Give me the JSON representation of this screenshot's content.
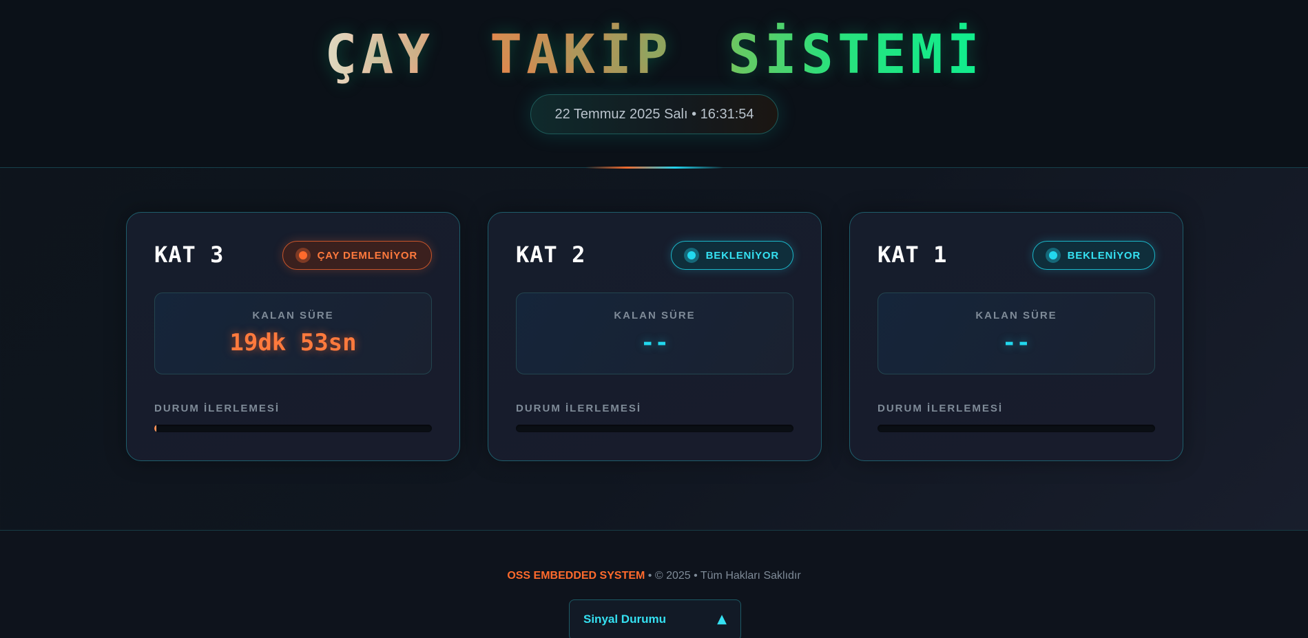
{
  "header": {
    "title_parts": [
      {
        "text": "ÇAY",
        "color": "#f0b896"
      },
      {
        "text": "TAKİP",
        "color": "#d98a4c"
      },
      {
        "text": "SİSTEMİ",
        "color": "#16e88c"
      }
    ],
    "datetime": "22 Temmuz 2025 Salı • 16:31:54"
  },
  "cards": [
    {
      "title": "KAT 3",
      "status": "ÇAY DEMLENİYOR",
      "status_type": "brewing",
      "status_color": "#ff7a3d",
      "remaining_label": "KALAN SÜRE",
      "remaining_value": "19dk 53sn",
      "progress_label": "DURUM İLERLEMESİ",
      "progress": 0.005
    },
    {
      "title": "KAT 2",
      "status": "BEKLENİYOR",
      "status_type": "waiting",
      "status_color": "#22d8ee",
      "remaining_label": "KALAN SÜRE",
      "remaining_value": "--",
      "progress_label": "DURUM İLERLEMESİ",
      "progress": 0
    },
    {
      "title": "KAT 1",
      "status": "BEKLENİYOR",
      "status_type": "waiting",
      "status_color": "#22d8ee",
      "remaining_label": "KALAN SÜRE",
      "remaining_value": "--",
      "progress_label": "DURUM İLERLEMESİ",
      "progress": 0
    }
  ],
  "footer": {
    "brand": "OSS EMBEDDED SYSTEM",
    "text": " • © 2025 • Tüm Hakları Saklıdır",
    "signal_label": "Sinyal Durumu",
    "signal_icon": "triangle-up-icon",
    "signal_glyph": "▲"
  }
}
